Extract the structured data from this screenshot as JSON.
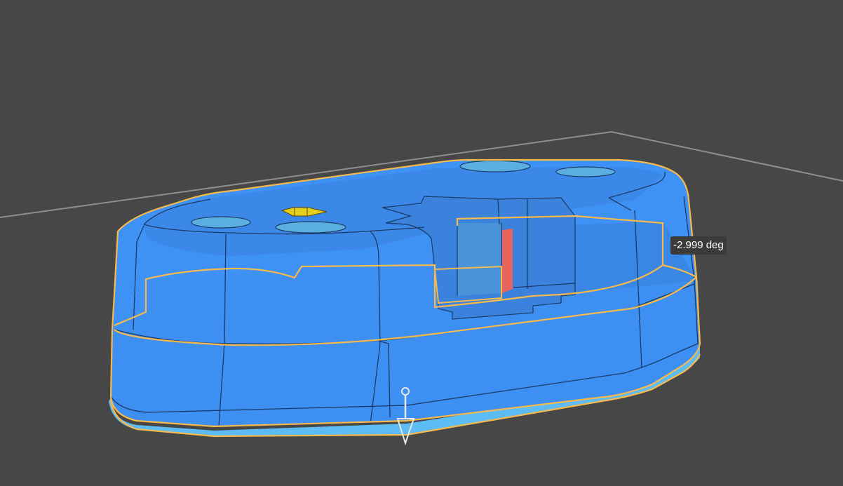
{
  "viewport": {
    "background_color": "#474747",
    "part_color": "#3f92f5",
    "part_dark_color": "#3579d6",
    "underside_color": "#5ebcf5",
    "selection_outline_color": "#f7b94c",
    "highlighted_face_color": "#e8645e",
    "marker_color": "#e6cf1c"
  },
  "rotation_readout": {
    "value": "-2.999 deg"
  },
  "icons": {
    "rotation_manipulator": "rotate-arrow-handle-icon",
    "marker": "yellow-diamond-marker-icon"
  }
}
